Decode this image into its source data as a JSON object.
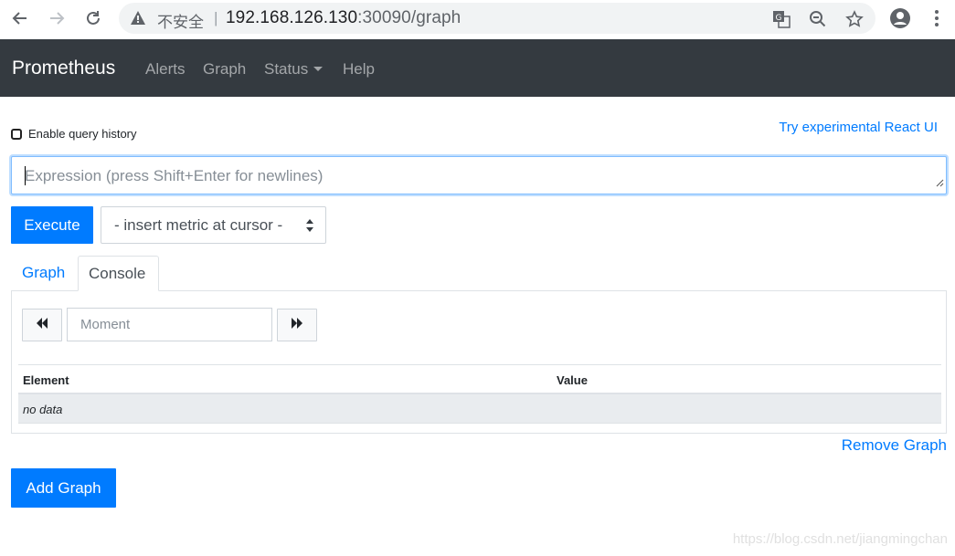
{
  "browser": {
    "insecure_label": "不安全",
    "separator": "|",
    "url_host": "192.168.126.130",
    "url_path": ":30090/graph"
  },
  "navbar": {
    "brand": "Prometheus",
    "items": [
      {
        "label": "Alerts"
      },
      {
        "label": "Graph"
      },
      {
        "label": "Status"
      },
      {
        "label": "Help"
      }
    ]
  },
  "main": {
    "history_label": "Enable query history",
    "react_link": "Try experimental React UI",
    "expression_placeholder": "Expression (press Shift+Enter for newlines)",
    "execute_label": "Execute",
    "metric_select": "- insert metric at cursor -",
    "tabs": [
      {
        "label": "Graph",
        "active": false
      },
      {
        "label": "Console",
        "active": true
      }
    ],
    "moment_placeholder": "Moment",
    "table": {
      "columns": [
        "Element",
        "Value"
      ],
      "empty_text": "no data"
    },
    "remove_graph": "Remove Graph",
    "add_graph": "Add Graph"
  },
  "watermark": "https://blog.csdn.net/jiangmingchan",
  "colors": {
    "accent": "#007bff",
    "navbar": "#343a40"
  }
}
